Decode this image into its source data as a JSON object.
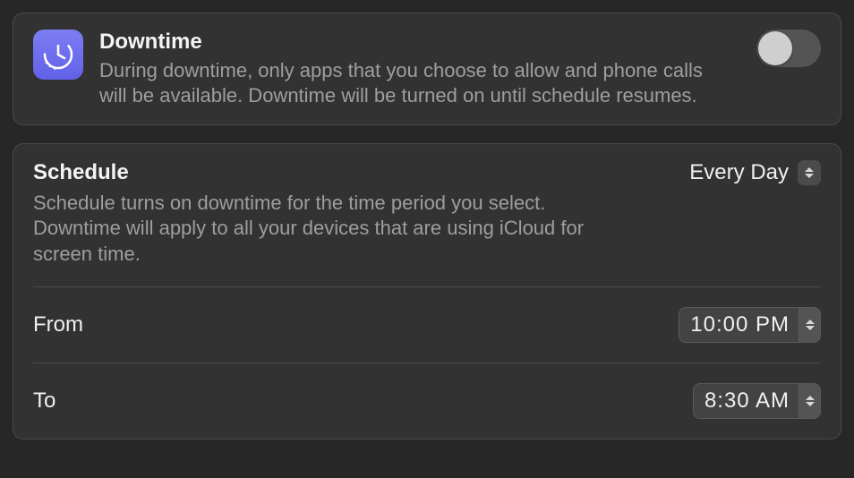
{
  "downtime": {
    "title": "Downtime",
    "description": "During downtime, only apps that you choose to allow and phone calls will be available. Downtime will be turned on until schedule resumes.",
    "enabled": false
  },
  "schedule": {
    "title": "Schedule",
    "description": "Schedule turns on downtime for the time period you select. Downtime will apply to all your devices that are using iCloud for screen time.",
    "mode": "Every Day",
    "from_label": "From",
    "from_value": "10:00 PM",
    "to_label": "To",
    "to_value": "8:30 AM"
  }
}
